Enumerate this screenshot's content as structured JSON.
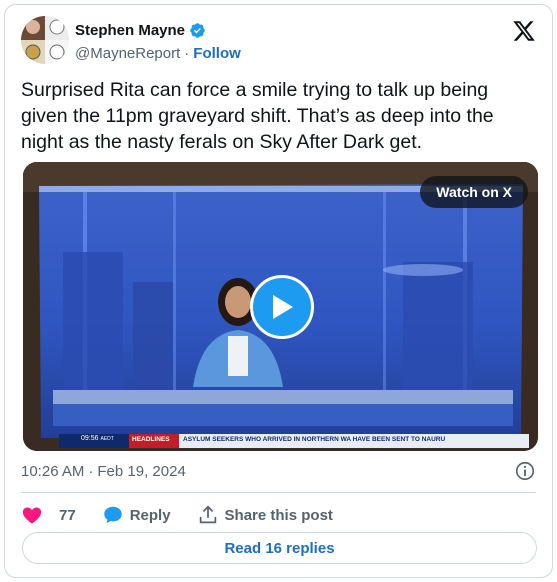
{
  "author": {
    "name": "Stephen Mayne",
    "handle": "@MayneReport",
    "separator": "·",
    "follow_label": "Follow"
  },
  "tweet": {
    "text": "Surprised Rita can force a smile trying to talk up being given the 11pm graveyard shift. That’s as deep into the night as the nasty ferals on Sky After Dark get."
  },
  "media": {
    "watch_label": "Watch on X",
    "ticker_time": "09:56",
    "ticker_zone": "AEDT",
    "ticker_section": "HEADLINES",
    "ticker_text": "ASYLUM SEEKERS WHO ARRIVED IN NORTHERN WA HAVE BEEN SENT TO NAURU"
  },
  "meta": {
    "time": "10:26 AM",
    "separator": "·",
    "date": "Feb 19, 2024"
  },
  "actions": {
    "like_count": "77",
    "reply_label": "Reply",
    "share_label": "Share this post"
  },
  "read_replies_label": "Read 16 replies",
  "colors": {
    "accent": "#1d9bf0",
    "link": "#1d6fbf",
    "like": "#f91880",
    "muted": "#536471"
  },
  "icons": [
    "verified-badge-icon",
    "x-logo-icon",
    "play-icon",
    "info-icon",
    "heart-icon",
    "reply-bubble-icon",
    "share-icon"
  ]
}
